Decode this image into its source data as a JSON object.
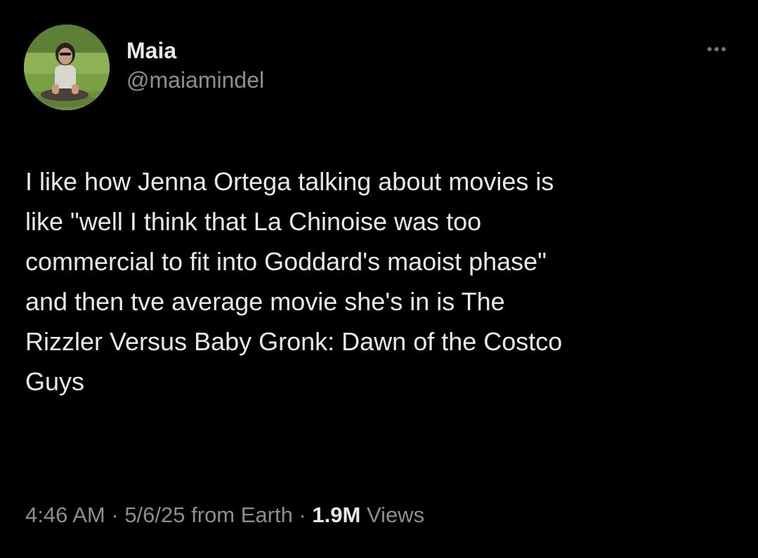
{
  "author": {
    "display_name": "Maia",
    "handle": "@maiamindel",
    "avatar_icon": "profile-photo-avatar"
  },
  "more_icon": "more-horizontal-icon",
  "tweet": {
    "text": "I like how Jenna Ortega talking about movies is\nlike \"well I think that La Chinoise was too\ncommercial to fit into Goddard's maoist phase\"\nand then tve average movie she's in is The\nRizzler Versus Baby Gronk: Dawn of the Costco\nGuys"
  },
  "meta": {
    "time": "4:46 AM",
    "separator1": " · ",
    "date": "5/6/25",
    "source": " from Earth",
    "separator2": " · ",
    "views_count": "1.9M",
    "views_label": " Views"
  },
  "colors": {
    "background": "#000000",
    "primary_text": "#e7e9ea",
    "secondary_text": "#8b8f94"
  }
}
